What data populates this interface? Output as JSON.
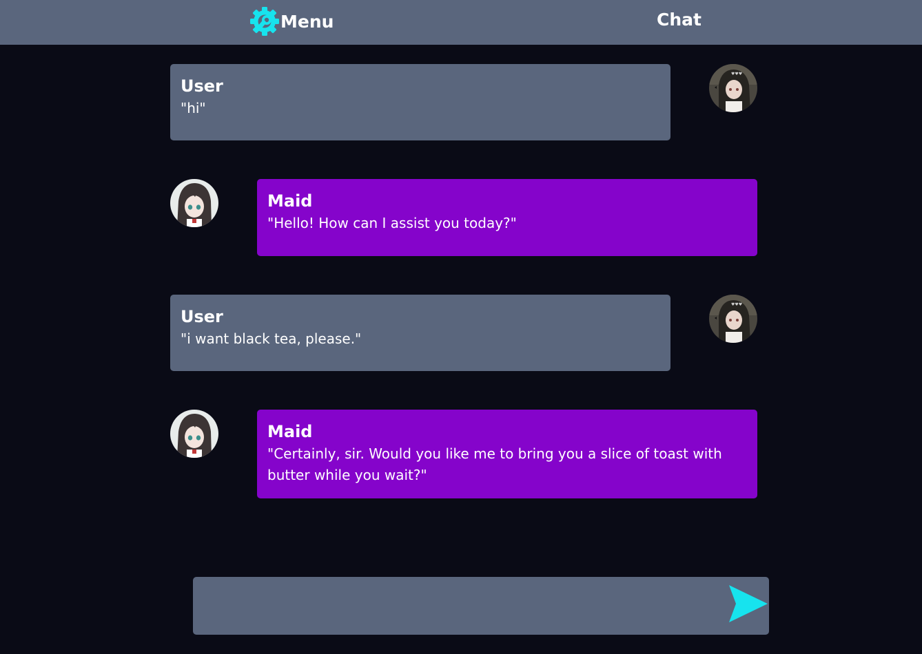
{
  "header": {
    "menu_label": "Menu",
    "chat_title": "Chat",
    "menu_icon": "wrench-gear-icon"
  },
  "messages": [
    {
      "role": "user",
      "sender": "User",
      "text": "\"hi\""
    },
    {
      "role": "maid",
      "sender": "Maid",
      "text": "\"Hello! How can I assist you today?\""
    },
    {
      "role": "user",
      "sender": "User",
      "text": "\"i want black tea, please.\""
    },
    {
      "role": "maid",
      "sender": "Maid",
      "text": "\"Certainly, sir. Would you like me to bring you a slice of toast with butter while you wait?\""
    }
  ],
  "composer": {
    "value": "",
    "placeholder": "",
    "send_icon": "send-arrow-icon"
  },
  "colors": {
    "background": "#0a0b16",
    "header": "#5a667d",
    "user_bubble": "#5a667d",
    "maid_bubble": "#8504cb",
    "accent": "#17e3ee"
  }
}
